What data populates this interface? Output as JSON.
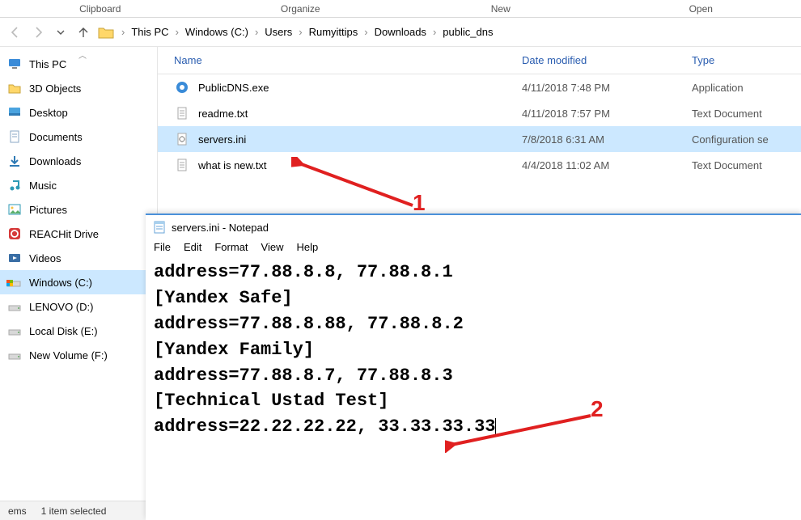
{
  "ribbon": {
    "groups": [
      "Clipboard",
      "Organize",
      "New",
      "Open"
    ]
  },
  "breadcrumb": [
    "This PC",
    "Windows (C:)",
    "Users",
    "Rumyittips",
    "Downloads",
    "public_dns"
  ],
  "sidebar": {
    "items": [
      {
        "label": "This PC",
        "icon": "monitor"
      },
      {
        "label": "3D Objects",
        "icon": "folder-yellow"
      },
      {
        "label": "Desktop",
        "icon": "desktop"
      },
      {
        "label": "Documents",
        "icon": "doc"
      },
      {
        "label": "Downloads",
        "icon": "downloads"
      },
      {
        "label": "Music",
        "icon": "music"
      },
      {
        "label": "Pictures",
        "icon": "pictures"
      },
      {
        "label": "REACHit Drive",
        "icon": "reachit"
      },
      {
        "label": "Videos",
        "icon": "videos"
      },
      {
        "label": "Windows (C:)",
        "icon": "drive-win",
        "selected": true
      },
      {
        "label": "LENOVO (D:)",
        "icon": "drive"
      },
      {
        "label": "Local Disk (E:)",
        "icon": "drive"
      },
      {
        "label": "New Volume (F:)",
        "icon": "drive"
      }
    ]
  },
  "columns": {
    "name": "Name",
    "date": "Date modified",
    "type": "Type"
  },
  "files": [
    {
      "name": "PublicDNS.exe",
      "date": "4/11/2018 7:48 PM",
      "type": "Application",
      "icon": "exe"
    },
    {
      "name": "readme.txt",
      "date": "4/11/2018 7:57 PM",
      "type": "Text Document",
      "icon": "txt"
    },
    {
      "name": "servers.ini",
      "date": "7/8/2018 6:31 AM",
      "type": "Configuration se",
      "icon": "ini",
      "selected": true
    },
    {
      "name": "what is new.txt",
      "date": "4/4/2018 11:02 AM",
      "type": "Text Document",
      "icon": "txt"
    }
  ],
  "notepad": {
    "title": "servers.ini - Notepad",
    "menu": [
      "File",
      "Edit",
      "Format",
      "View",
      "Help"
    ],
    "lines": [
      "address=77.88.8.8, 77.88.8.1",
      "[Yandex Safe]",
      "address=77.88.8.88, 77.88.8.2",
      "[Yandex Family]",
      "address=77.88.8.7, 77.88.8.3",
      "[Technical Ustad Test]",
      "address=22.22.22.22, 33.33.33.33"
    ]
  },
  "status": {
    "items_label": "ems",
    "selected_label": "1 item selected"
  },
  "annotations": {
    "one": "1",
    "two": "2"
  }
}
